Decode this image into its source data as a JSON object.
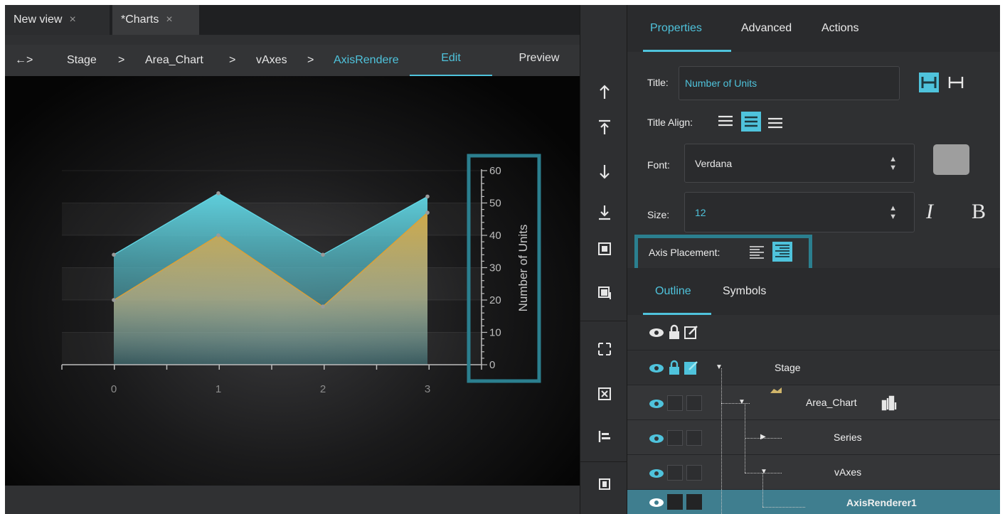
{
  "tabs": [
    {
      "label": "New view",
      "close": "×"
    },
    {
      "label": "*Charts",
      "close": "×"
    }
  ],
  "breadcrumb": {
    "back": "←>",
    "items": [
      "Stage",
      "Area_Chart",
      "vAxes",
      "AxisRendere"
    ],
    "sep": ">"
  },
  "view_tabs": {
    "edit": "Edit",
    "preview": "Preview"
  },
  "chart_data": {
    "type": "area",
    "x": [
      0,
      1,
      2,
      3
    ],
    "series": [
      {
        "values": [
          34,
          53,
          34,
          52
        ],
        "color": "#62d8e6"
      },
      {
        "values": [
          20,
          40,
          18,
          47
        ],
        "color": "#e2a030"
      }
    ],
    "ylim": [
      0,
      60
    ],
    "ylabel": "Number of Units",
    "yticks": [
      "0",
      "10",
      "20",
      "30",
      "40",
      "50",
      "60"
    ],
    "xticks": [
      "0",
      "1",
      "2",
      "3"
    ],
    "y_axis_position": "right",
    "grid": true
  },
  "properties_tabs": [
    "Properties",
    "Advanced",
    "Actions"
  ],
  "properties": {
    "title_label": "Title:",
    "title_value": "Number of Units",
    "title_align_label": "Title Align:",
    "font_label": "Font:",
    "font_value": "Verdana",
    "size_label": "Size:",
    "size_value": "12",
    "italic": "I",
    "bold": "B",
    "axis_placement_label": "Axis Placement:",
    "accent": "#4fc3dc",
    "highlight": "#2b7f8f"
  },
  "outline_tabs": [
    "Outline",
    "Symbols"
  ],
  "outline_rows": [
    {
      "name": "Stage"
    },
    {
      "name": "Area_Chart"
    },
    {
      "name": "Series"
    },
    {
      "name": "vAxes"
    },
    {
      "name": "AxisRenderer1"
    }
  ]
}
